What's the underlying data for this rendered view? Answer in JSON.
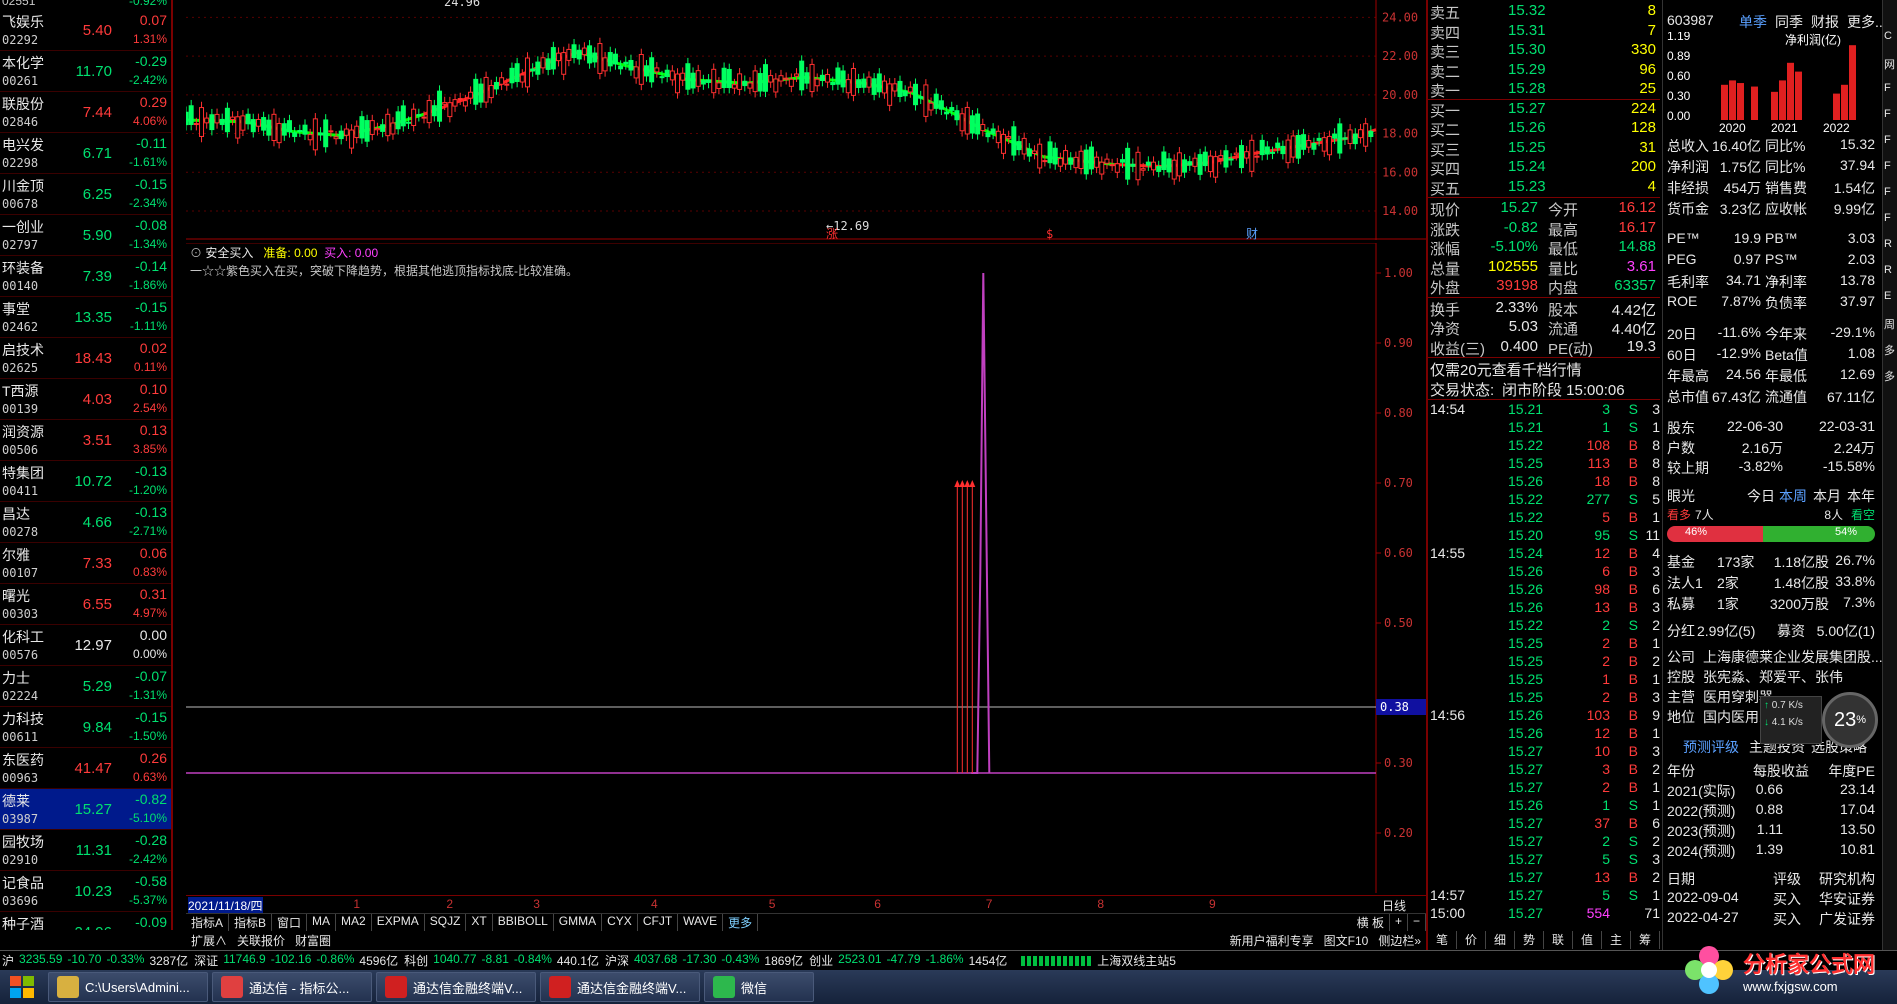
{
  "watchlist": [
    {
      "name": "飞娱乐",
      "code": "02292",
      "price": "5.40",
      "chg": "0.07",
      "pct": "1.31%",
      "dir": "up"
    },
    {
      "name": "本化学",
      "code": "00261",
      "price": "11.70",
      "chg": "-0.29",
      "pct": "-2.42%",
      "dir": "down"
    },
    {
      "name": "联股份",
      "code": "02846",
      "price": "7.44",
      "chg": "0.29",
      "pct": "4.06%",
      "dir": "up"
    },
    {
      "name": "电兴发",
      "code": "02298",
      "price": "6.71",
      "chg": "-0.11",
      "pct": "-1.61%",
      "dir": "down"
    },
    {
      "name": "川金顶",
      "code": "00678",
      "price": "6.25",
      "chg": "-0.15",
      "pct": "-2.34%",
      "dir": "down"
    },
    {
      "name": "一创业",
      "code": "02797",
      "price": "5.90",
      "chg": "-0.08",
      "pct": "-1.34%",
      "dir": "down"
    },
    {
      "name": "环装备",
      "code": "00140",
      "price": "7.39",
      "chg": "-0.14",
      "pct": "-1.86%",
      "dir": "down"
    },
    {
      "name": "事堂",
      "code": "02462",
      "price": "13.35",
      "chg": "-0.15",
      "pct": "-1.11%",
      "dir": "down"
    },
    {
      "name": "启技术",
      "code": "02625",
      "price": "18.43",
      "chg": "0.02",
      "pct": "0.11%",
      "dir": "up"
    },
    {
      "name": "T西源",
      "code": "00139",
      "price": "4.03",
      "chg": "0.10",
      "pct": "2.54%",
      "dir": "up"
    },
    {
      "name": "润资源",
      "code": "00506",
      "price": "3.51",
      "chg": "0.13",
      "pct": "3.85%",
      "dir": "up"
    },
    {
      "name": "特集团",
      "code": "00411",
      "price": "10.72",
      "chg": "-0.13",
      "pct": "-1.20%",
      "dir": "down"
    },
    {
      "name": "昌达",
      "code": "00278",
      "price": "4.66",
      "chg": "-0.13",
      "pct": "-2.71%",
      "dir": "down"
    },
    {
      "name": "尔雅",
      "code": "00107",
      "price": "7.33",
      "chg": "0.06",
      "pct": "0.83%",
      "dir": "up"
    },
    {
      "name": "曙光",
      "code": "00303",
      "price": "6.55",
      "chg": "0.31",
      "pct": "4.97%",
      "dir": "up"
    },
    {
      "name": "化科工",
      "code": "00576",
      "price": "12.97",
      "chg": "0.00",
      "pct": "0.00%",
      "dir": "flat"
    },
    {
      "name": "力士",
      "code": "02224",
      "price": "5.29",
      "chg": "-0.07",
      "pct": "-1.31%",
      "dir": "down"
    },
    {
      "name": "力科技",
      "code": "00611",
      "price": "9.84",
      "chg": "-0.15",
      "pct": "-1.50%",
      "dir": "down"
    },
    {
      "name": "东医药",
      "code": "00963",
      "price": "41.47",
      "chg": "0.26",
      "pct": "0.63%",
      "dir": "up"
    },
    {
      "name": "德莱",
      "code": "03987",
      "price": "15.27",
      "chg": "-0.82",
      "pct": "-5.10%",
      "dir": "down",
      "selected": true
    },
    {
      "name": "园牧场",
      "code": "02910",
      "price": "11.31",
      "chg": "-0.28",
      "pct": "-2.42%",
      "dir": "down"
    },
    {
      "name": "记食品",
      "code": "03696",
      "price": "10.23",
      "chg": "-0.58",
      "pct": "-5.37%",
      "dir": "down"
    },
    {
      "name": "种子酒",
      "code": "",
      "price": "24.96",
      "chg": "-0.09",
      "pct": "",
      "dir": "down"
    }
  ],
  "watchlist_top": {
    "code": "02551",
    "pct": "-0.92%"
  },
  "price_axis": [
    "24.00",
    "22.00",
    "20.00",
    "18.00",
    "16.00",
    "14.00"
  ],
  "price_marks": {
    "high": "24.96",
    "low": "12.69"
  },
  "event_marks": [
    "涨",
    "$",
    "财"
  ],
  "indicator": {
    "name": "安全买入",
    "prep_label": "准备:",
    "prep_value": "0.00",
    "buy_label": "买入:",
    "buy_value": "0.00",
    "description": "一☆☆紫色买入在买，突破下降趋势，根据其他逃顶指标找底-比较准确。",
    "axis": [
      "1.00",
      "0.90",
      "0.80",
      "0.70",
      "0.60",
      "0.50",
      "0.30",
      "0.20"
    ],
    "cursor_value": "0.38"
  },
  "date_bar": {
    "start": "2021/11/18/四",
    "months": [
      "1",
      "2",
      "3",
      "4",
      "5",
      "6",
      "7",
      "8",
      "9"
    ],
    "right": "日线"
  },
  "tabs": [
    "指标A",
    "指标B",
    "窗口",
    "MA",
    "MA2",
    "EXPMA",
    "SQJZ",
    "XT",
    "BBIBOLL",
    "GMMA",
    "CYX",
    "CFJT",
    "WAVE",
    "更多"
  ],
  "tabs_right": [
    "横 板",
    "+",
    "−"
  ],
  "tabs2": [
    "扩展∧",
    "关联报价",
    "财富圈"
  ],
  "tabs2_right": [
    "新用户福利专享",
    "图文F10",
    "侧边栏»"
  ],
  "quote": {
    "sells": [
      {
        "label": "卖五",
        "price": "15.32",
        "vol": "8"
      },
      {
        "label": "卖四",
        "price": "15.31",
        "vol": "7"
      },
      {
        "label": "卖三",
        "price": "15.30",
        "vol": "330"
      },
      {
        "label": "卖二",
        "price": "15.29",
        "vol": "96"
      },
      {
        "label": "卖一",
        "price": "15.28",
        "vol": "25"
      }
    ],
    "buys": [
      {
        "label": "买一",
        "price": "15.27",
        "vol": "224"
      },
      {
        "label": "买二",
        "price": "15.26",
        "vol": "128"
      },
      {
        "label": "买三",
        "price": "15.25",
        "vol": "31"
      },
      {
        "label": "买四",
        "price": "15.24",
        "vol": "200"
      },
      {
        "label": "买五",
        "price": "15.23",
        "vol": "4"
      }
    ],
    "stats": [
      {
        "l1": "现价",
        "v1": "15.27",
        "c1": "down",
        "l2": "今开",
        "v2": "16.12",
        "c2": "up"
      },
      {
        "l1": "涨跌",
        "v1": "-0.82",
        "c1": "down",
        "l2": "最高",
        "v2": "16.17",
        "c2": "up"
      },
      {
        "l1": "涨幅",
        "v1": "-5.10%",
        "c1": "down",
        "l2": "最低",
        "v2": "14.88",
        "c2": "down"
      },
      {
        "l1": "总量",
        "v1": "102555",
        "c1": "yellow",
        "l2": "量比",
        "v2": "3.61",
        "c2": "purple"
      },
      {
        "l1": "外盘",
        "v1": "39198",
        "c1": "up",
        "l2": "内盘",
        "v2": "63357",
        "c2": "down"
      }
    ],
    "stats2": [
      {
        "l1": "换手",
        "v1": "2.33%",
        "l2": "股本",
        "v2": "4.42亿"
      },
      {
        "l1": "净资",
        "v1": "5.03",
        "l2": "流通",
        "v2": "4.40亿"
      },
      {
        "l1": "收益(三)",
        "v1": "0.400",
        "l2": "PE(动)",
        "v2": "19.3"
      }
    ],
    "promo": "仅需20元查看千档行情",
    "status_label": "交易状态:",
    "status_value": "闭市阶段 15:00:06"
  },
  "ticks": [
    {
      "time": "14:54",
      "price": "15.21",
      "vol": "3",
      "bs": "S",
      "n": "3"
    },
    {
      "time": "",
      "price": "15.21",
      "vol": "1",
      "bs": "S",
      "n": "1"
    },
    {
      "time": "",
      "price": "15.22",
      "vol": "108",
      "bs": "B",
      "n": "8"
    },
    {
      "time": "",
      "price": "15.25",
      "vol": "113",
      "bs": "B",
      "n": "8"
    },
    {
      "time": "",
      "price": "15.26",
      "vol": "18",
      "bs": "B",
      "n": "8"
    },
    {
      "time": "",
      "price": "15.22",
      "vol": "277",
      "bs": "S",
      "n": "5"
    },
    {
      "time": "",
      "price": "15.22",
      "vol": "5",
      "bs": "B",
      "n": "1"
    },
    {
      "time": "",
      "price": "15.20",
      "vol": "95",
      "bs": "S",
      "n": "11"
    },
    {
      "time": "14:55",
      "price": "15.24",
      "vol": "12",
      "bs": "B",
      "n": "4"
    },
    {
      "time": "",
      "price": "15.26",
      "vol": "6",
      "bs": "B",
      "n": "3"
    },
    {
      "time": "",
      "price": "15.26",
      "vol": "98",
      "bs": "B",
      "n": "6"
    },
    {
      "time": "",
      "price": "15.26",
      "vol": "13",
      "bs": "B",
      "n": "3"
    },
    {
      "time": "",
      "price": "15.22",
      "vol": "2",
      "bs": "S",
      "n": "2"
    },
    {
      "time": "",
      "price": "15.25",
      "vol": "2",
      "bs": "B",
      "n": "1"
    },
    {
      "time": "",
      "price": "15.25",
      "vol": "2",
      "bs": "B",
      "n": "2"
    },
    {
      "time": "",
      "price": "15.25",
      "vol": "1",
      "bs": "B",
      "n": "1"
    },
    {
      "time": "",
      "price": "15.25",
      "vol": "2",
      "bs": "B",
      "n": "3"
    },
    {
      "time": "14:56",
      "price": "15.26",
      "vol": "103",
      "bs": "B",
      "n": "9"
    },
    {
      "time": "",
      "price": "15.26",
      "vol": "12",
      "bs": "B",
      "n": "1"
    },
    {
      "time": "",
      "price": "15.27",
      "vol": "10",
      "bs": "B",
      "n": "3"
    },
    {
      "time": "",
      "price": "15.27",
      "vol": "3",
      "bs": "B",
      "n": "2"
    },
    {
      "time": "",
      "price": "15.27",
      "vol": "2",
      "bs": "B",
      "n": "1"
    },
    {
      "time": "",
      "price": "15.26",
      "vol": "1",
      "bs": "S",
      "n": "1"
    },
    {
      "time": "",
      "price": "15.27",
      "vol": "37",
      "bs": "B",
      "n": "6"
    },
    {
      "time": "",
      "price": "15.27",
      "vol": "2",
      "bs": "S",
      "n": "2"
    },
    {
      "time": "",
      "price": "15.27",
      "vol": "5",
      "bs": "S",
      "n": "3"
    },
    {
      "time": "",
      "price": "15.27",
      "vol": "13",
      "bs": "B",
      "n": "2"
    },
    {
      "time": "14:57",
      "price": "15.27",
      "vol": "5",
      "bs": "S",
      "n": "1"
    },
    {
      "time": "15:00",
      "price": "15.27",
      "vol": "554",
      "bs": "",
      "n": "71"
    }
  ],
  "f10": {
    "code": "603987",
    "tabs": [
      "单季",
      "同季",
      "财报",
      "更多..."
    ],
    "chart_title": "净利润(亿)",
    "chart_y": [
      "1.19",
      "0.89",
      "0.60",
      "0.30",
      "0.00"
    ],
    "chart_years": [
      "2020",
      "2021",
      "2022"
    ],
    "fin": [
      {
        "l1": "总收入",
        "v1": "16.40亿",
        "l2": "同比%",
        "v2": "15.32"
      },
      {
        "l1": "净利润",
        "v1": "1.75亿",
        "l2": "同比%",
        "v2": "37.94"
      },
      {
        "l1": "非经损",
        "v1": "454万",
        "l2": "销售费",
        "v2": "1.54亿"
      },
      {
        "l1": "货币金",
        "v1": "3.23亿",
        "l2": "应收帐",
        "v2": "9.99亿"
      }
    ],
    "val": [
      {
        "l1": "PE™",
        "v1": "19.9",
        "l2": "PB™",
        "v2": "3.03"
      },
      {
        "l1": "PEG",
        "v1": "0.97",
        "l2": "PS™",
        "v2": "2.03"
      },
      {
        "l1": "毛利率",
        "v1": "34.71",
        "l2": "净利率",
        "v2": "13.78"
      },
      {
        "l1": "ROE",
        "v1": "7.87%",
        "l2": "负债率",
        "v2": "37.97"
      }
    ],
    "perf": [
      {
        "l1": "20日",
        "v1": "-11.6%",
        "l2": "今年来",
        "v2": "-29.1%"
      },
      {
        "l1": "60日",
        "v1": "-12.9%",
        "l2": "Beta值",
        "v2": "1.08"
      },
      {
        "l1": "年最高",
        "v1": "24.56",
        "l2": "年最低",
        "v2": "12.69"
      },
      {
        "l1": "总市值",
        "v1": "67.43亿",
        "l2": "流通值",
        "v2": "67.11亿"
      }
    ],
    "holders": [
      {
        "l1": "股东",
        "v1": "22-06-30",
        "v2": "22-03-31"
      },
      {
        "l1": "户数",
        "v1": "2.16万",
        "v2": "2.24万"
      },
      {
        "l1": "较上期",
        "v1": "-3.82%",
        "v2": "-15.58%"
      }
    ],
    "sentiment": {
      "label": "眼光",
      "tabs": [
        "今日",
        "本周",
        "本月",
        "本年"
      ],
      "bull": "看多",
      "bull_count": "7人",
      "bear_count": "8人",
      "bear": "看空",
      "bull_pct": "46%",
      "bear_pct": "54%",
      "bull_share": 0.46
    },
    "inst": [
      {
        "l1": "基金",
        "v1": "173家",
        "v2": "1.18亿股",
        "v3": "26.7%"
      },
      {
        "l1": "法人1",
        "v1": "2家",
        "v2": "1.48亿股",
        "v3": "33.8%"
      },
      {
        "l1": "私募",
        "v1": "1家",
        "v2": "3200万股",
        "v3": "7.3%"
      }
    ],
    "dividend": {
      "l1": "分红",
      "v1": "2.99亿(5)",
      "l2": "募资",
      "v2": "5.00亿(1)"
    },
    "company": [
      {
        "l": "公司",
        "v": "上海康德莱企业发展集团股..."
      },
      {
        "l": "控股",
        "v": "张宪淼、郑爱平、张伟"
      },
      {
        "l": "主营",
        "v": "医用穿刺器"
      },
      {
        "l": "地位",
        "v": "国内医用穿"
      }
    ],
    "forecast_tabs": [
      "预测评级",
      "主题投资",
      "选股策略"
    ],
    "forecast_head": [
      "年份",
      "每股收益",
      "年度PE"
    ],
    "forecast": [
      {
        "y": "2021(实际)",
        "eps": "0.66",
        "pe": "23.14"
      },
      {
        "y": "2022(预测)",
        "eps": "0.88",
        "pe": "17.04"
      },
      {
        "y": "2023(预测)",
        "eps": "1.11",
        "pe": "13.50"
      },
      {
        "y": "2024(预测)",
        "eps": "1.39",
        "pe": "10.81"
      }
    ],
    "rating_head": [
      "日期",
      "评级",
      "研究机构"
    ],
    "ratings": [
      {
        "d": "2022-09-04",
        "r": "买入",
        "org": "华安证券"
      },
      {
        "d": "2022-04-27",
        "r": "买入",
        "org": "广发证券"
      }
    ],
    "bottom_tabs": [
      "笔",
      "价",
      "细",
      "势",
      "联",
      "值",
      "主",
      "筹"
    ],
    "gauge": "23",
    "gauge_unit": "%",
    "speed_up": "0.7",
    "speed_down": "4.1",
    "speed_unit": "K/s"
  },
  "side_strip": [
    "C",
    "网",
    "F",
    "F",
    "F",
    "F",
    "F",
    "F",
    "R",
    "R",
    "E",
    "周",
    "多",
    "多"
  ],
  "status_bar": [
    {
      "label": "沪",
      "value": "3235.59",
      "chg": "-10.70",
      "pct": "-0.33%",
      "amt": "3287亿"
    },
    {
      "label": "深证",
      "value": "11746.9",
      "chg": "-102.16",
      "pct": "-0.86%",
      "amt": "4596亿"
    },
    {
      "label": "科创",
      "value": "1040.77",
      "chg": "-8.81",
      "pct": "-0.84%",
      "amt": "440.1亿"
    },
    {
      "label": "沪深",
      "value": "4037.68",
      "chg": "-17.30",
      "pct": "-0.43%",
      "amt": "1869亿"
    },
    {
      "label": "创业",
      "value": "2523.01",
      "chg": "-47.79",
      "pct": "-1.86%",
      "amt": "1454亿"
    }
  ],
  "status_site": "上海双线主站5",
  "taskbar": [
    {
      "label": "C:\\Users\\Admini...",
      "color": "#d8b040"
    },
    {
      "label": "通达信 - 指标公...",
      "color": "#e04040"
    },
    {
      "label": "通达信金融终端V...",
      "color": "#d02020"
    },
    {
      "label": "通达信金融终端V...",
      "color": "#d02020"
    },
    {
      "label": "微信",
      "color": "#2db84d"
    }
  ],
  "watermark": {
    "title": "分析家公式网",
    "url": "www.fxjgsw.com"
  },
  "chart_data": {
    "type": "line",
    "title": "",
    "series": [
      {
        "name": "",
        "color": "#ff2020",
        "role": "ma_down_segment"
      },
      {
        "name": "",
        "color": "#00ff00",
        "role": "ma_up_segment"
      }
    ],
    "x": [
      "2021/11/18",
      "1",
      "2",
      "3",
      "4",
      "5",
      "6",
      "7",
      "8",
      "9"
    ],
    "ma_points": [
      [
        0,
        18.7
      ],
      [
        0.05,
        18.6
      ],
      [
        0.09,
        18.1
      ],
      [
        0.13,
        17.9
      ],
      [
        0.17,
        18.4
      ],
      [
        0.2,
        19.0
      ],
      [
        0.24,
        19.9
      ],
      [
        0.28,
        21.0
      ],
      [
        0.31,
        21.8
      ],
      [
        0.33,
        22.2
      ],
      [
        0.37,
        21.5
      ],
      [
        0.42,
        20.8
      ],
      [
        0.47,
        20.6
      ],
      [
        0.52,
        20.9
      ],
      [
        0.57,
        20.6
      ],
      [
        0.61,
        20.1
      ],
      [
        0.64,
        19.2
      ],
      [
        0.67,
        18.2
      ],
      [
        0.7,
        17.4
      ],
      [
        0.72,
        16.8
      ],
      [
        0.75,
        16.6
      ],
      [
        0.78,
        16.4
      ],
      [
        0.82,
        16.3
      ],
      [
        0.86,
        16.5
      ],
      [
        0.9,
        17.0
      ],
      [
        0.94,
        17.4
      ],
      [
        0.98,
        17.8
      ],
      [
        1.0,
        18.2
      ]
    ],
    "price_ylim": [
      12.5,
      24.9
    ],
    "indicator_series": {
      "name": "安全买入",
      "color": "#c040c0",
      "spike_at": 0.67,
      "spike_value": 1.0,
      "signal_level": 0.7
    },
    "indicator_ylim": [
      0,
      1.0
    ]
  }
}
